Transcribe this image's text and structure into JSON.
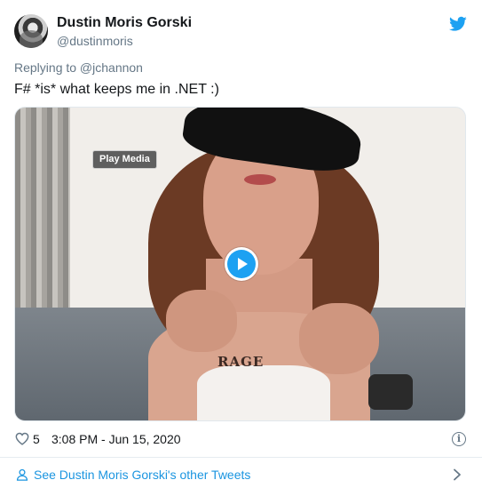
{
  "author": {
    "name": "Dustin Moris Gorski",
    "handle": "@dustinmoris"
  },
  "tweet": {
    "replying_to": "Replying to @jchannon",
    "text": "F# *is* what keeps me in .NET :)"
  },
  "media": {
    "play_media_label": "Play Media",
    "tattoo_text": "RAGE"
  },
  "meta": {
    "likes": "5",
    "timestamp": "3:08 PM - Jun 15, 2020",
    "info_glyph": "i"
  },
  "footer": {
    "see_tweets_label": "See Dustin Moris Gorski's other Tweets"
  },
  "colors": {
    "twitter_blue": "#1da1f2",
    "link_blue": "#1b95e0",
    "muted_gray": "#657786"
  },
  "icons": {
    "brand": "twitter-bird-icon",
    "like": "heart-icon",
    "info": "info-icon",
    "profile": "user-icon",
    "more": "chevron-right-icon",
    "play": "play-icon"
  }
}
